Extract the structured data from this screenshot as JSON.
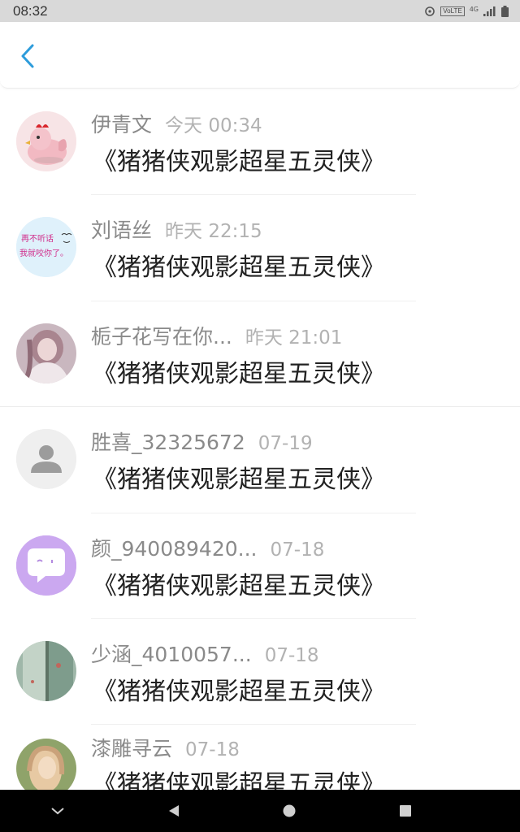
{
  "status_bar": {
    "time": "08:32",
    "volte": "VoLTE",
    "network": "4G"
  },
  "header": {
    "back_icon": "chevron-left-icon",
    "accent_color": "#2d9cdb"
  },
  "list": {
    "items": [
      {
        "name": "伊青文",
        "time": "今天 00:34",
        "message": "《猪猪侠观影超星五灵侠》",
        "avatar": "pink-chicken-toy"
      },
      {
        "name": "刘语丝",
        "time": "昨天 22:15",
        "message": "《猪猪侠观影超星五灵侠》",
        "avatar": "text-sticker",
        "avatar_text_1": "再不听话",
        "avatar_text_2": "我就咬你了。"
      },
      {
        "name": "栀子花写在你...",
        "time": "昨天 21:01",
        "message": "《猪猪侠观影超星五灵侠》",
        "avatar": "girl-photo"
      },
      {
        "name": "胜喜_32325672",
        "time": "07-19",
        "message": "《猪猪侠观影超星五灵侠》",
        "avatar": "default-user"
      },
      {
        "name": "颜_940089420...",
        "time": "07-18",
        "message": "《猪猪侠观影超星五灵侠》",
        "avatar": "purple-chat-bubble"
      },
      {
        "name": "少涵_4010057...",
        "time": "07-18",
        "message": "《猪猪侠观影超星五灵侠》",
        "avatar": "green-window-photo"
      },
      {
        "name": "漆雕寻云",
        "time": "07-18",
        "message": "《猪猪侠观影超星五灵侠》",
        "avatar": "woman-photo"
      }
    ]
  },
  "nav_bar": {
    "buttons": [
      "collapse-icon",
      "back-triangle-icon",
      "home-circle-icon",
      "recents-square-icon"
    ]
  }
}
